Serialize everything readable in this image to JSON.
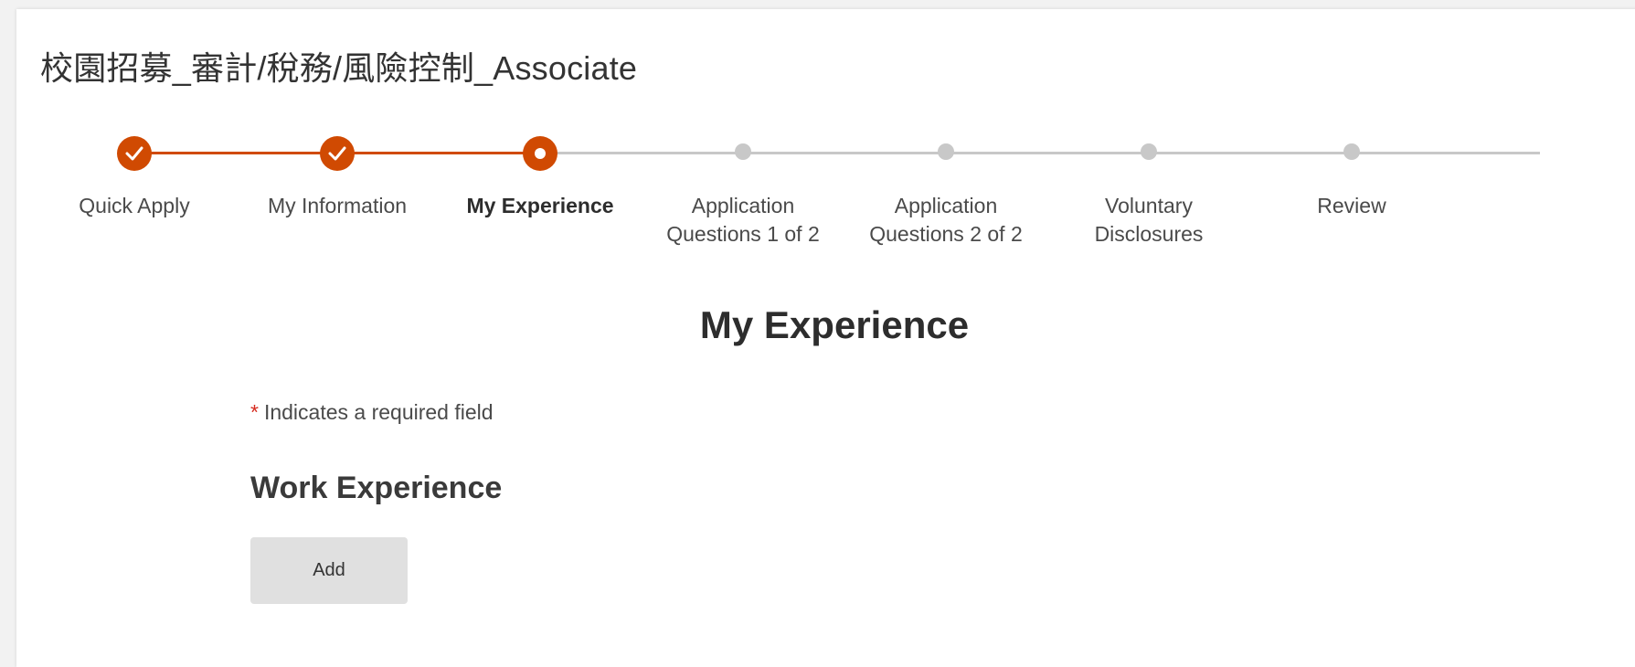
{
  "job_title": "校園招募_審計/稅務/風險控制_Associate",
  "stepper": {
    "steps": [
      {
        "label_line1": "Quick Apply",
        "label_line2": "",
        "status": "completed"
      },
      {
        "label_line1": "My Information",
        "label_line2": "",
        "status": "completed"
      },
      {
        "label_line1": "My Experience",
        "label_line2": "",
        "status": "current"
      },
      {
        "label_line1": "Application",
        "label_line2": "Questions 1 of 2",
        "status": "upcoming"
      },
      {
        "label_line1": "Application",
        "label_line2": "Questions 2 of 2",
        "status": "upcoming"
      },
      {
        "label_line1": "Voluntary",
        "label_line2": "Disclosures",
        "status": "upcoming"
      },
      {
        "label_line1": "Review",
        "label_line2": "",
        "status": "upcoming"
      }
    ],
    "completed_icon": "check-icon",
    "accent_color": "#d04a02",
    "inactive_color": "#c8c8c8"
  },
  "main": {
    "heading": "My Experience",
    "required_marker": "*",
    "required_note": "Indicates a required field",
    "work_experience": {
      "heading": "Work Experience",
      "add_label": "Add"
    }
  }
}
